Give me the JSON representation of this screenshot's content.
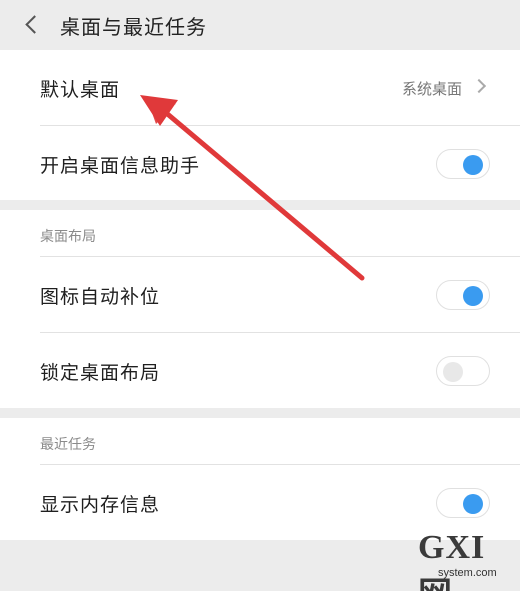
{
  "header": {
    "title": "桌面与最近任务",
    "back_icon": "back-chevron-icon"
  },
  "section_1": {
    "rows": [
      {
        "label": "默认桌面",
        "value": "系统桌面",
        "type": "link"
      },
      {
        "label": "开启桌面信息助手",
        "type": "toggle",
        "on": true
      }
    ]
  },
  "section_2": {
    "header": "桌面布局",
    "rows": [
      {
        "label": "图标自动补位",
        "type": "toggle",
        "on": true
      },
      {
        "label": "锁定桌面布局",
        "type": "toggle",
        "on": false
      }
    ]
  },
  "section_3": {
    "header": "最近任务",
    "rows": [
      {
        "label": "显示内存信息",
        "type": "toggle",
        "on": true
      }
    ]
  },
  "watermark": {
    "main": "GXI网",
    "sub": "system.com"
  },
  "colors": {
    "accent": "#3a9bf0",
    "annotation_arrow": "#e0393a",
    "background": "#ececec"
  }
}
